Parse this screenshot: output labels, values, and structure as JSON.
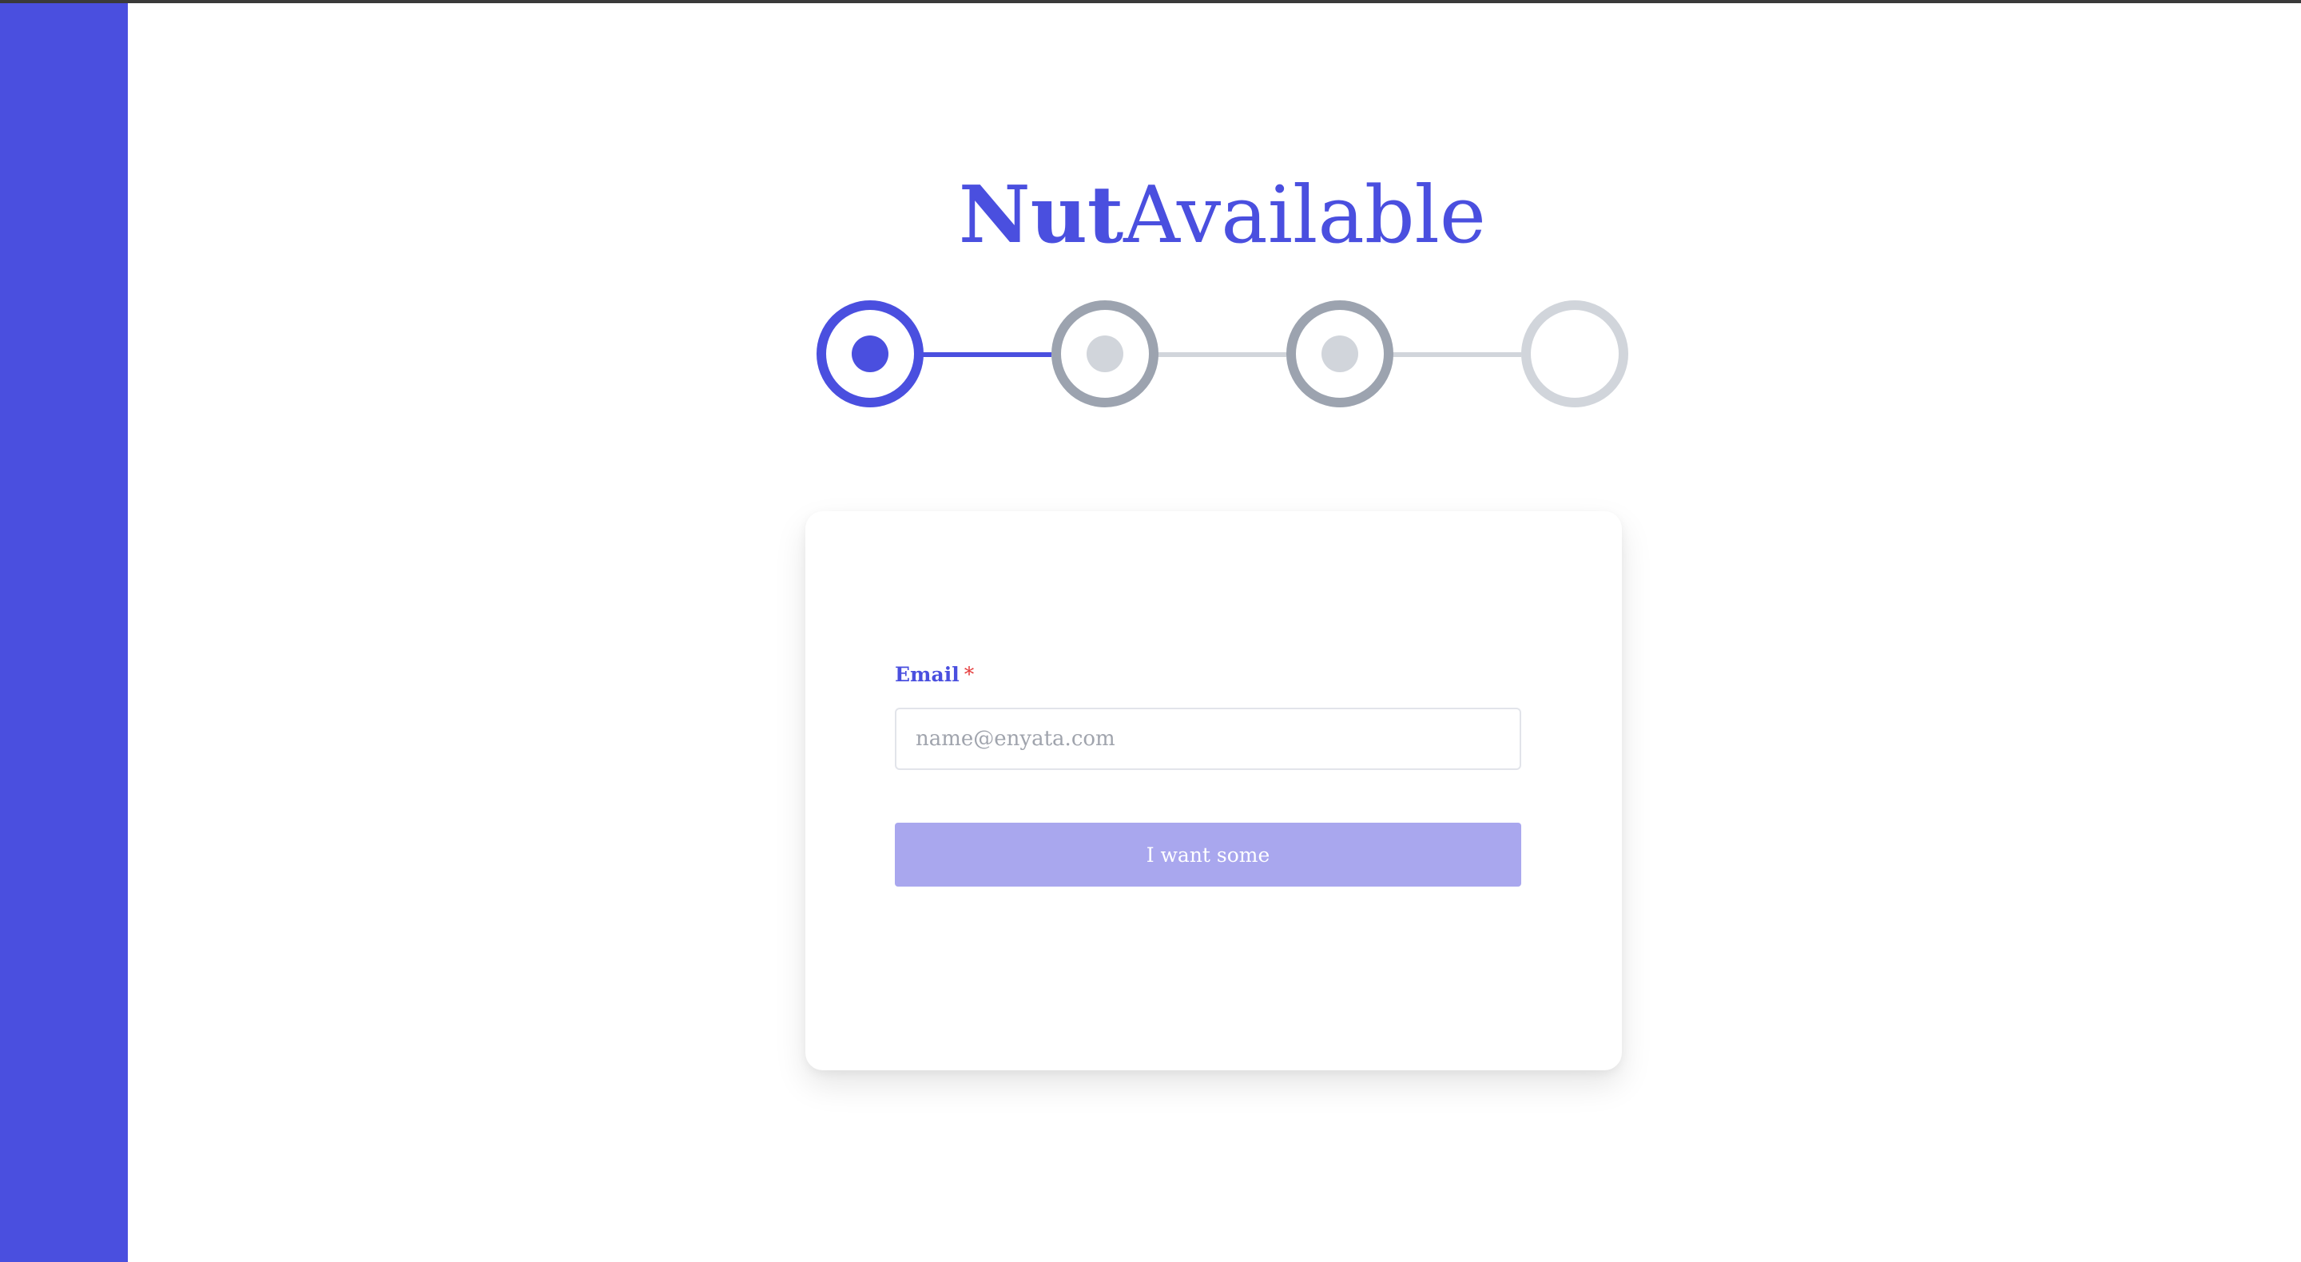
{
  "brand": {
    "name_bold": "Nut",
    "name_light": "Available",
    "color": "#4a4fdf"
  },
  "stepper": {
    "total_steps": 4,
    "current_step": 1,
    "colors": {
      "active": "#4a4fdf",
      "pending_ring": "#9ca3af",
      "pending_dot": "#d1d5db",
      "future_ring": "#d1d5db",
      "line_done": "#4a4fdf",
      "line_pending": "#d1d5db"
    }
  },
  "form": {
    "email_label": "Email",
    "required_marker": "*",
    "email_value": "",
    "email_placeholder": "name@enyata.com",
    "submit_label": "I want some",
    "submit_color": "#a9a7ee"
  },
  "sidebar": {
    "color": "#4a4fdf"
  }
}
